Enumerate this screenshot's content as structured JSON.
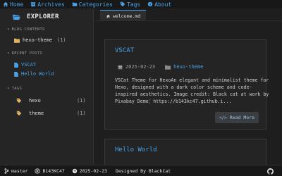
{
  "nav": {
    "items": [
      {
        "icon": "home-icon",
        "label": "Home"
      },
      {
        "icon": "archive-icon",
        "label": "Archives"
      },
      {
        "icon": "folder-icon",
        "label": "Categories"
      },
      {
        "icon": "tag-icon",
        "label": "Tags"
      },
      {
        "icon": "info-icon",
        "label": "About"
      }
    ]
  },
  "sidebar": {
    "title": "EXPLORER",
    "blog_contents": {
      "header": "BLOG CONTENTS",
      "items": [
        {
          "label": "hexo-theme",
          "count": "(1)"
        }
      ]
    },
    "recent_posts": {
      "header": "RECENT POSTS",
      "items": [
        {
          "label": "VSCAT"
        },
        {
          "label": "Hello World"
        }
      ]
    },
    "tags": {
      "header": "TAGS",
      "items": [
        {
          "label": "hexo",
          "count": "(1)"
        },
        {
          "label": "theme",
          "count": "(1)"
        }
      ]
    }
  },
  "editor": {
    "tab": {
      "label": "welcome.md"
    }
  },
  "posts": [
    {
      "title": "VSCAT",
      "date": "2025-02-23",
      "category": "hexo-theme",
      "excerpt": "VSCat Theme for HexoAn elegant and minimalist theme for Hexo, designed with a dark color scheme and code-inspired aesthetics. Image credit: Black cat at work by Pixabay Demo：https://b143kc47.github.i...",
      "read_more": "Read More"
    },
    {
      "title": "Hello World"
    }
  ],
  "status": {
    "branch": "master",
    "user": "B143KC47",
    "date": "2025-02-23",
    "credit": "Designed By BlackCat"
  },
  "colors": {
    "accent": "#4aa3e8",
    "background": "#1e1e1e",
    "sidebar": "#252526"
  }
}
